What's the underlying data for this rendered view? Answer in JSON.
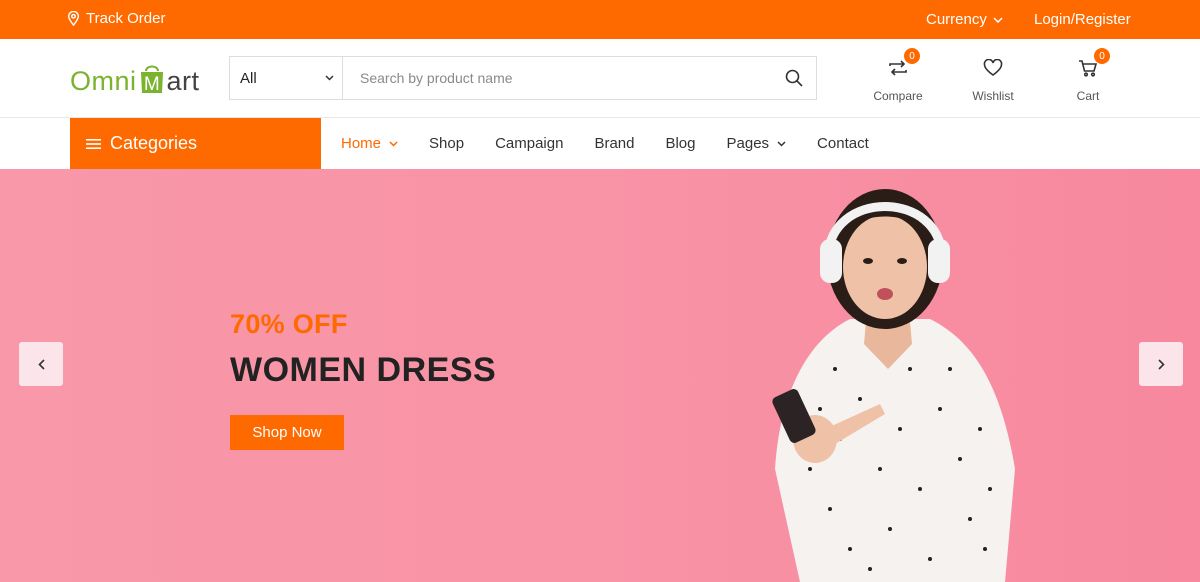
{
  "topbar": {
    "track_label": "Track Order",
    "currency_label": "Currency",
    "login_label": "Login/Register",
    "bg_color": "#ff6a00"
  },
  "header": {
    "logo_left": "Omni",
    "logo_m": "M",
    "logo_right": "art",
    "search": {
      "category_value": "All",
      "placeholder": "Search by product name"
    },
    "actions": [
      {
        "label": "Compare",
        "count": "0",
        "icon": "compare-icon"
      },
      {
        "label": "Wishlist",
        "icon": "heart-icon"
      },
      {
        "label": "Cart",
        "count": "0",
        "icon": "cart-icon"
      }
    ]
  },
  "nav": {
    "categories_label": "Categories",
    "items": [
      {
        "label": "Home"
      },
      {
        "label": "Shop"
      },
      {
        "label": "Campaign"
      },
      {
        "label": "Brand"
      },
      {
        "label": "Blog"
      },
      {
        "label": "Pages"
      },
      {
        "label": "Contact"
      }
    ]
  },
  "hero": {
    "subtitle": "70% OFF",
    "title": "WOMEN DRESS",
    "button_label": "Shop Now",
    "accent_color": "#ff6a00",
    "bg_color": "#f993a6"
  }
}
